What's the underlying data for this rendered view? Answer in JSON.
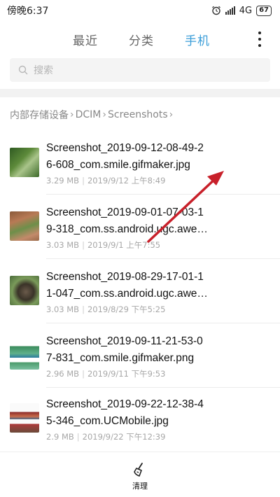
{
  "status_bar": {
    "time": "傍晚6:37",
    "network": "4G",
    "battery": "67",
    "alarm_icon": "alarm-icon",
    "signal_icon": "signal-icon"
  },
  "tabs": [
    {
      "label": "最近",
      "active": false
    },
    {
      "label": "分类",
      "active": false
    },
    {
      "label": "手机",
      "active": true
    }
  ],
  "search": {
    "placeholder": "搜索",
    "icon": "search-icon"
  },
  "breadcrumb": [
    "内部存储设备",
    "DCIM",
    "Screenshots"
  ],
  "files": [
    {
      "name": "Screenshot_2019-09-12-08-49-2\n6-608_com.smile.gifmaker.jpg",
      "size": "3.29 MB",
      "date": "2019/9/12 上午8:49"
    },
    {
      "name": "Screenshot_2019-09-01-07-03-1\n9-318_com.ss.android.ugc.awe…",
      "size": "3.03 MB",
      "date": "2019/9/1 上午7:55"
    },
    {
      "name": "Screenshot_2019-08-29-17-01-1\n1-047_com.ss.android.ugc.awe…",
      "size": "3.03 MB",
      "date": "2019/8/29 下午5:25"
    },
    {
      "name": "Screenshot_2019-09-11-21-53-0\n7-831_com.smile.gifmaker.png",
      "size": "2.96 MB",
      "date": "2019/9/11 下午9:53"
    },
    {
      "name": "Screenshot_2019-09-22-12-38-4\n5-346_com.UCMobile.jpg",
      "size": "2.9 MB",
      "date": "2019/9/22 下午12:39"
    }
  ],
  "bottom": {
    "clean_label": "清理",
    "icon": "broom-icon"
  },
  "colors": {
    "accent": "#3a9dd8",
    "arrow": "#c8202a"
  }
}
